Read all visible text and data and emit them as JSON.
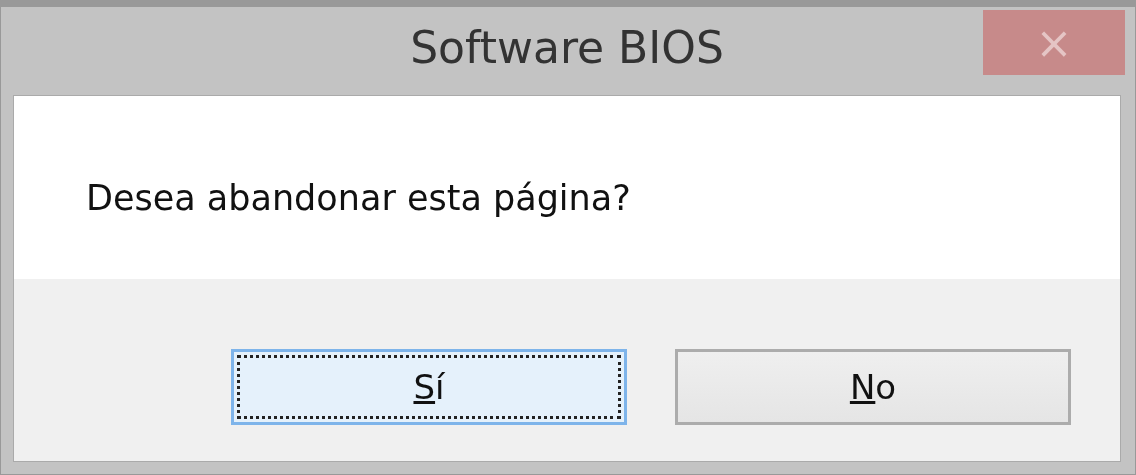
{
  "window": {
    "title": "Software BIOS",
    "close": "×"
  },
  "message": "Desea abandonar esta página?",
  "buttons": [
    {
      "label": "Sí",
      "default": true
    },
    {
      "label": "No",
      "default": false
    }
  ]
}
